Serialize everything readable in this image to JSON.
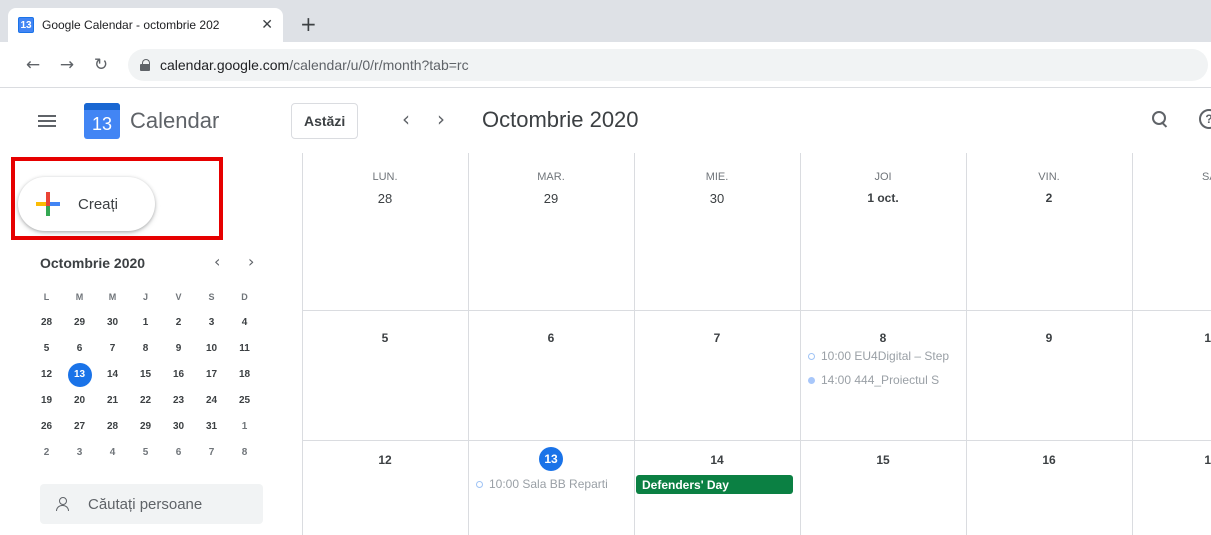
{
  "browser": {
    "tab_title": "Google Calendar - octombrie 202",
    "tab_favicon_text": "13",
    "url_domain": "calendar.google.com",
    "url_path": "/calendar/u/0/r/month?tab=rc"
  },
  "header": {
    "logo_day": "13",
    "app_name": "Calendar",
    "today_label": "Astăzi",
    "prev_glyph": "‹",
    "next_glyph": "›",
    "month_title": "Octombrie 2020",
    "help_glyph": "?"
  },
  "sidebar": {
    "create_label": "Creați",
    "mini_title": "Octombrie 2020",
    "mini_prev": "‹",
    "mini_next": "›",
    "weekdays": [
      "L",
      "M",
      "M",
      "J",
      "V",
      "S",
      "D"
    ],
    "weeks": [
      [
        "28",
        "29",
        "30",
        "1",
        "2",
        "3",
        "4"
      ],
      [
        "5",
        "6",
        "7",
        "8",
        "9",
        "10",
        "11"
      ],
      [
        "12",
        "13",
        "14",
        "15",
        "16",
        "17",
        "18"
      ],
      [
        "19",
        "20",
        "21",
        "22",
        "23",
        "24",
        "25"
      ],
      [
        "26",
        "27",
        "28",
        "29",
        "30",
        "31",
        "1"
      ],
      [
        "2",
        "3",
        "4",
        "5",
        "6",
        "7",
        "8"
      ]
    ],
    "people_placeholder": "Căutați persoane"
  },
  "month": {
    "day_headers": [
      "LUN.",
      "MAR.",
      "MIE.",
      "JOI",
      "VIN.",
      "SÂ"
    ],
    "week1": [
      "28",
      "29",
      "30",
      "1 oct.",
      "2"
    ],
    "week2": [
      "5",
      "6",
      "7",
      "8",
      "9",
      "1"
    ],
    "week3": [
      "12",
      "13",
      "14",
      "15",
      "16",
      "1"
    ],
    "events": {
      "oct8_a": "10:00 EU4Digital – Step",
      "oct8_b": "14:00 444_Proiectul S",
      "oct13_a": "10:00 Sala BB Reparti",
      "oct14_allday": "Defenders' Day"
    }
  },
  "colors": {
    "today_blue": "#1a73e8",
    "event_green": "#0b8043",
    "highlight_red": "#e60000"
  }
}
